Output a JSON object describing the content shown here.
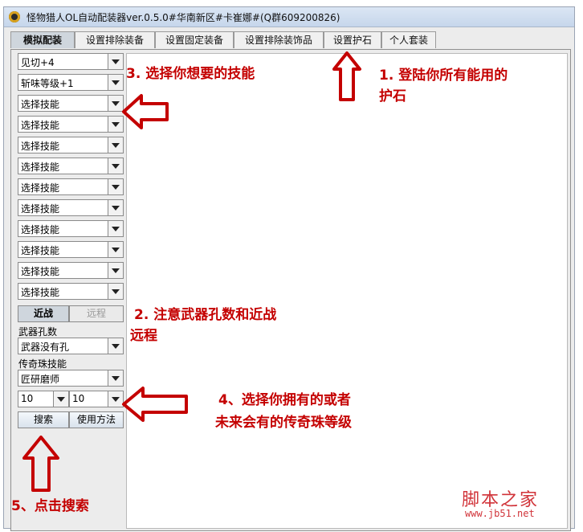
{
  "window": {
    "title": "怪物猎人OL自动配装器ver.0.5.0#华南新区#卡崔娜#(Q群609200826)"
  },
  "tabs": [
    {
      "label": "模拟配装",
      "active": true
    },
    {
      "label": "设置排除装备",
      "active": false
    },
    {
      "label": "设置固定装备",
      "active": false
    },
    {
      "label": "设置排除装饰品",
      "active": false
    },
    {
      "label": "设置护石",
      "active": false
    },
    {
      "label": "个人套装",
      "active": false
    }
  ],
  "skills": [
    {
      "value": "见切+4"
    },
    {
      "value": "斩味等级+1"
    },
    {
      "value": "选择技能"
    },
    {
      "value": "选择技能"
    },
    {
      "value": "选择技能"
    },
    {
      "value": "选择技能"
    },
    {
      "value": "选择技能"
    },
    {
      "value": "选择技能"
    },
    {
      "value": "选择技能"
    },
    {
      "value": "选择技能"
    },
    {
      "value": "选择技能"
    },
    {
      "value": "选择技能"
    }
  ],
  "attack_type": {
    "melee": "近战",
    "ranged": "远程",
    "selected": "melee"
  },
  "weapon_slots": {
    "label": "武器孔数",
    "value": "武器没有孔"
  },
  "legend_skill": {
    "label": "传奇珠技能",
    "value": "匠研磨师"
  },
  "levels": {
    "left": "10",
    "right": "10"
  },
  "buttons": {
    "search": "搜索",
    "help": "使用方法"
  },
  "annotations": {
    "step1_line1": "1. 登陆你所有能用的",
    "step1_line2": "护石",
    "step2_line1": "2. 注意武器孔数和近战",
    "step2_line2": "远程",
    "step3": "3. 选择你想要的技能",
    "step4_line1": "4、选择你拥有的或者",
    "step4_line2": "未来会有的传奇珠等级",
    "step5": "5、点击搜索"
  },
  "watermark": {
    "site": "脚本之家",
    "url": "www.jb51.net"
  },
  "colors": {
    "annotation": "#c40000",
    "watermark": "#d1343a",
    "active_tab": "#cfd6dd"
  }
}
